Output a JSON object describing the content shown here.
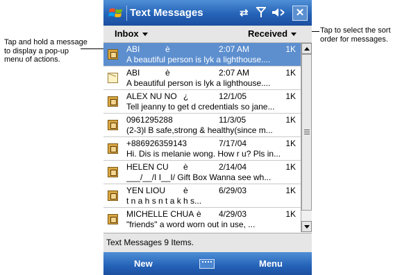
{
  "callouts": {
    "left": "Tap and hold a message to display a pop-up menu of actions.",
    "right": "Tap to select the sort order for messages."
  },
  "titlebar": {
    "title": "Text Messages",
    "icons": [
      "sync-icon",
      "signal-icon",
      "speaker-icon",
      "close-icon"
    ],
    "close_label": "✕"
  },
  "menubar": {
    "folder": "Inbox",
    "sort": "Received"
  },
  "messages": [
    {
      "name": "ABI",
      "mark": "è",
      "time": "2:07 AM",
      "size": "1K",
      "preview": "A beautiful person is  lyk a  lighthouse....",
      "icon": "sms-icon",
      "selected": true
    },
    {
      "name": "ABI",
      "mark": "è",
      "time": "2:07 AM",
      "size": "1K",
      "preview": "A beautiful person is  lyk a  lighthouse....",
      "icon": "envelope-open-icon",
      "selected": false
    },
    {
      "name": "ALEX NU NO",
      "mark": "¿",
      "time": "12/1/05",
      "size": "1K",
      "preview": "Tell jeanny to get d credentials so jane...",
      "icon": "sms-icon",
      "selected": false
    },
    {
      "name": "0961295288",
      "mark": "",
      "time": "11/3/05",
      "size": "1K",
      "preview": "(2-3)l B safe,strong & healthy(since m...",
      "icon": "sms-icon",
      "selected": false
    },
    {
      "name": "+886926359143",
      "mark": "",
      "time": "7/17/04",
      "size": "1K",
      "preview": "Hi. Dis is melanie wong. How r u? Pls in...",
      "icon": "sms-icon",
      "selected": false
    },
    {
      "name": "HELEN CU",
      "mark": "è",
      "time": "2/14/04",
      "size": "1K",
      "preview": "___/__/I I__I/ Gift Box Wanna see wh...",
      "icon": "sms-icon",
      "selected": false
    },
    {
      "name": "YEN LIOU",
      "mark": "è",
      "time": "6/29/03",
      "size": "1K",
      "preview": "t  n  a  h  s    n t  a      k  h    s...",
      "icon": "sms-icon",
      "selected": false
    },
    {
      "name": "MICHELLE CHUA",
      "mark": "è",
      "time": "4/29/03",
      "size": "1K",
      "preview": "\"friends\"    a word worn out in use,   ...",
      "icon": "sms-icon",
      "selected": false
    }
  ],
  "status": "Text Messages  9 Items.",
  "softkeys": {
    "left": "New",
    "right": "Menu",
    "middle_icon": "keyboard-icon"
  },
  "colors": {
    "bar_blue": "#2563b8",
    "selection": "#5d8fcf"
  }
}
